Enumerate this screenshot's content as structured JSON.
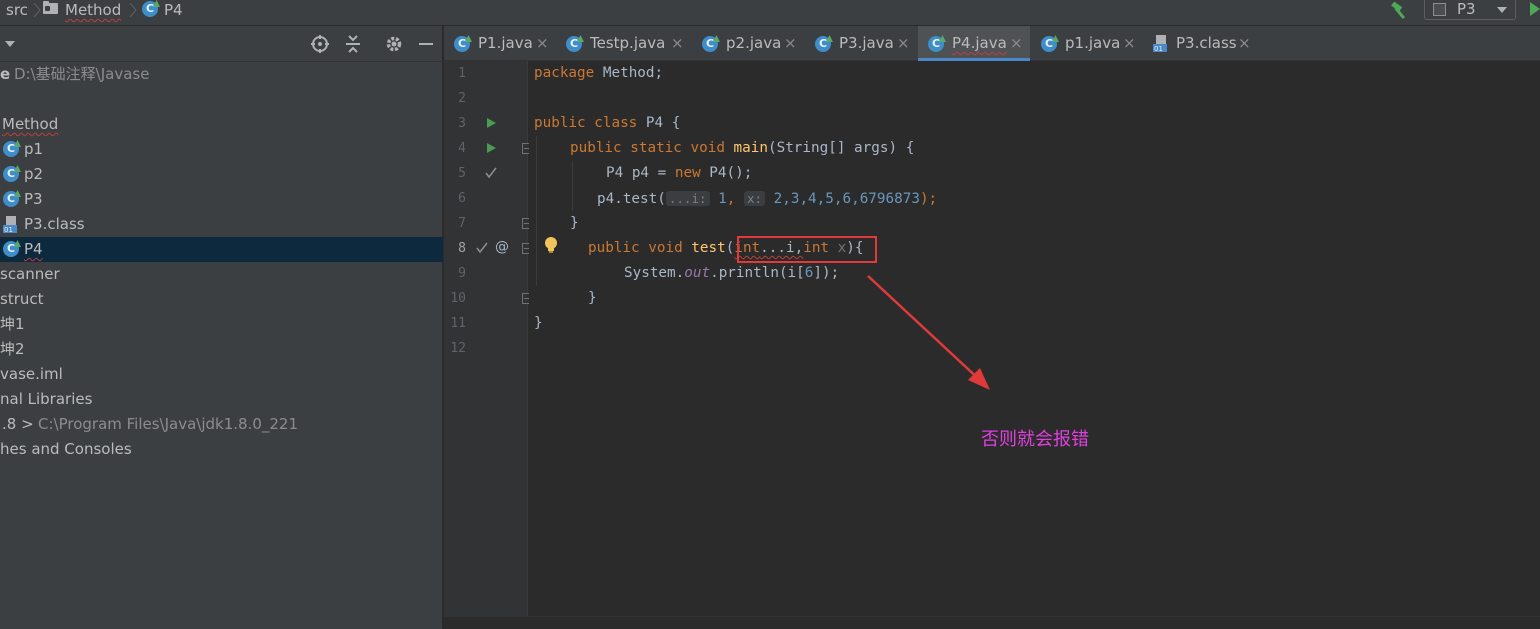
{
  "breadcrumb": {
    "items": [
      "src",
      "Method",
      "P4"
    ]
  },
  "toolbar": {
    "run_config": "P3"
  },
  "project": {
    "root_path": "D:\\基础注释\\Javase",
    "root_suffix": "e",
    "items": [
      {
        "label": "Method",
        "type": "package",
        "squiggle": true
      },
      {
        "label": "p1",
        "type": "class"
      },
      {
        "label": "p2",
        "type": "class"
      },
      {
        "label": "P3",
        "type": "class"
      },
      {
        "label": "P3.class",
        "type": "classfile"
      },
      {
        "label": "P4",
        "type": "class",
        "selected": true,
        "squiggle": true
      },
      {
        "label": "scanner",
        "type": "folder"
      },
      {
        "label": "struct",
        "type": "folder"
      },
      {
        "label": "坤1",
        "type": "folder"
      },
      {
        "label": "坤2",
        "type": "folder"
      },
      {
        "label": "vase.iml",
        "type": "file"
      },
      {
        "label": "nal Libraries",
        "type": "libraries"
      },
      {
        "label": ".8 >",
        "type": "jdk",
        "detail": "C:\\Program Files\\Java\\jdk1.8.0_221"
      },
      {
        "label": "hes and Consoles",
        "type": "scratches"
      }
    ]
  },
  "tabs": [
    {
      "label": "P1.java",
      "icon": "C"
    },
    {
      "label": "Testp.java",
      "icon": "C"
    },
    {
      "label": "p2.java",
      "icon": "C"
    },
    {
      "label": "P3.java",
      "icon": "C"
    },
    {
      "label": "P4.java",
      "icon": "C",
      "active": true
    },
    {
      "label": "p1.java",
      "icon": "C"
    },
    {
      "label": "P3.class",
      "icon": "class"
    }
  ],
  "tab_close_glyph": "×",
  "editor": {
    "line_numbers": [
      "1",
      "2",
      "3",
      "4",
      "5",
      "6",
      "7",
      "8",
      "9",
      "10",
      "11",
      "12"
    ],
    "current_line": "8",
    "code": {
      "l1_kw": "package",
      "l1_rest": " Method;",
      "l3_kw": "public class",
      "l3_rest": " P4 {",
      "l4_kw": "public static void",
      "l4_fn": "main",
      "l4_rest": "(String[] args) {",
      "l5_a": "P4 p4 = ",
      "l5_kw": "new",
      "l5_rest": " P4();",
      "l6_a": "p4.test(",
      "l6_hint1": "...i:",
      "l6_n1": "1",
      "l6_c1": ", ",
      "l6_hint2": "x:",
      "l6_nums": "2,3,4,5,6,6796873",
      "l6_end": ");",
      "l7": "}",
      "l8_kw": "public void",
      "l8_fn": "test",
      "l8_p1": "(",
      "l8_kw2": "int",
      "l8_dots": "...i,",
      "l8_kw3": "int",
      "l8_x": " x",
      "l8_end": "){",
      "l9_a": "System.",
      "l9_field": "out",
      "l9_b": ".println(i[",
      "l9_num": "6",
      "l9_end": "]);",
      "l10": "}",
      "l11": "}"
    }
  },
  "annotation": {
    "text": "否则就会报错",
    "color": "#e040e0"
  },
  "colors": {
    "keyword": "#cc7832",
    "function": "#ffc66d",
    "number": "#6897bb",
    "field": "#9876aa",
    "default_text": "#a9b7c6",
    "selection": "#0d293e",
    "red_box": "#e03a3a"
  }
}
